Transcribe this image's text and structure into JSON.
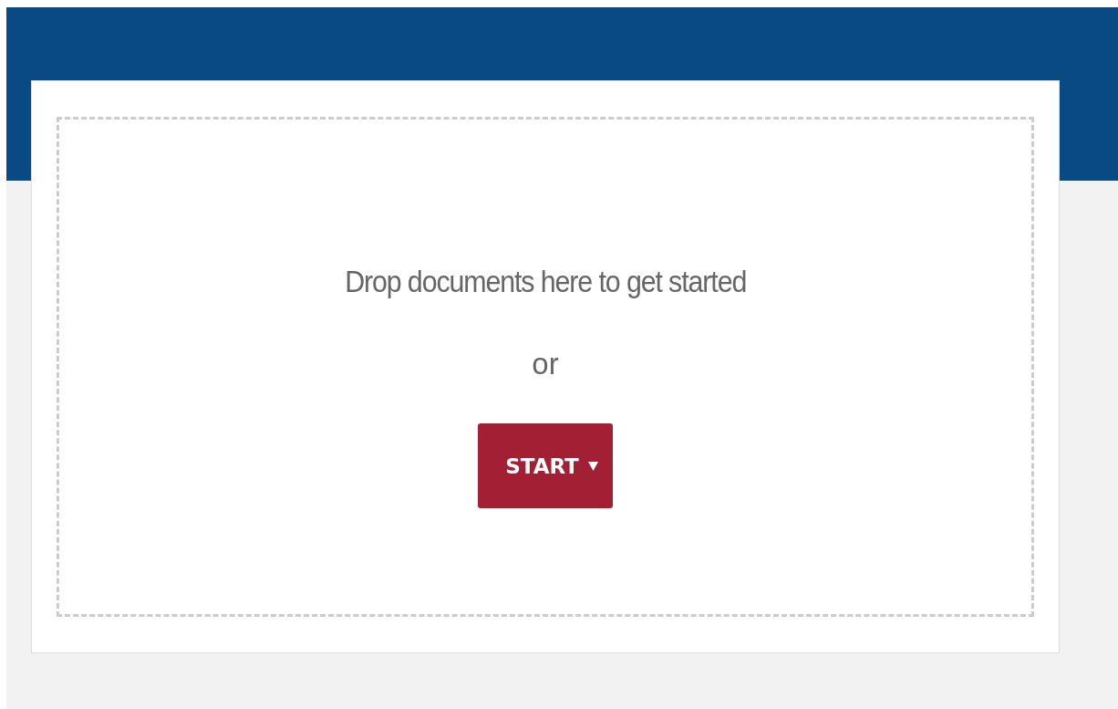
{
  "drop_zone": {
    "prompt": "Drop documents here to get started",
    "separator": "or"
  },
  "start_button": {
    "label": "START",
    "has_menu": true
  }
}
